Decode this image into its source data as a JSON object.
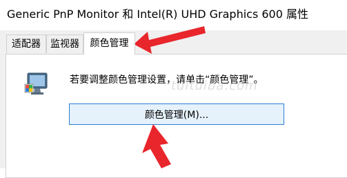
{
  "window": {
    "title": "Generic PnP Monitor 和 Intel(R) UHD Graphics 600 属性"
  },
  "tabs": [
    {
      "label": "适配器",
      "active": false
    },
    {
      "label": "监视器",
      "active": false
    },
    {
      "label": "颜色管理",
      "active": true
    }
  ],
  "content": {
    "description": "若要调整颜色管理设置，请单击“颜色管理”。",
    "button_label": "颜色管理(M)...",
    "watermark": "tuituiba.com"
  },
  "icons": {
    "monitor": "color-monitor-icon"
  },
  "colors": {
    "annotation_arrow": "#e8262b",
    "button_border": "#2b7cd3",
    "button_bg": "#e5f1fb"
  }
}
